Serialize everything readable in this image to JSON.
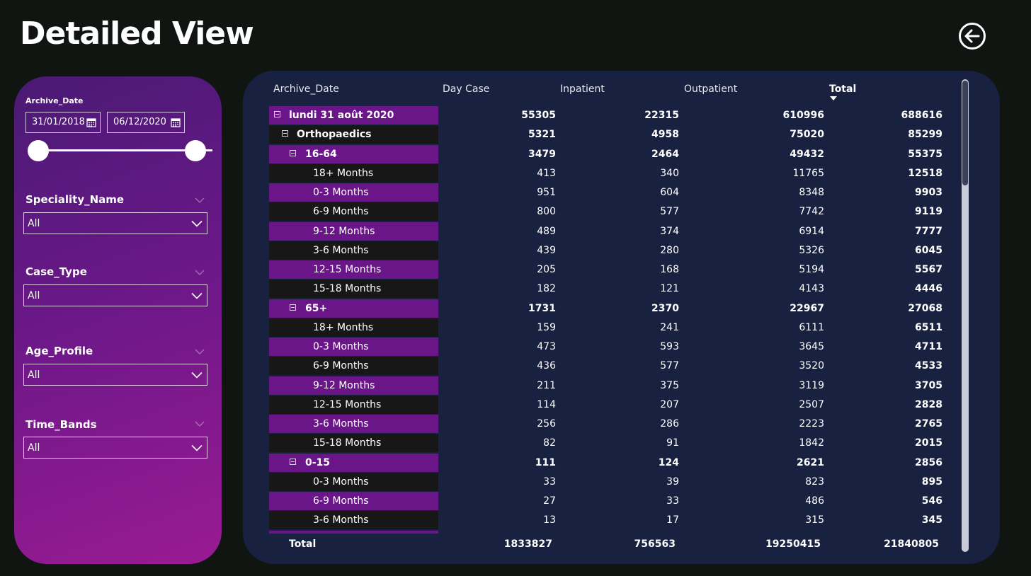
{
  "page": {
    "title": "Detailed View"
  },
  "date_filter": {
    "label": "Archive_Date",
    "start": "31/01/2018",
    "end": "06/12/2020"
  },
  "filters": [
    {
      "label": "Speciality_Name",
      "value": "All"
    },
    {
      "label": "Case_Type",
      "value": "All"
    },
    {
      "label": "Age_Profile",
      "value": "All"
    },
    {
      "label": "Time_Bands",
      "value": "All"
    }
  ],
  "table": {
    "columns": [
      "Archive_Date",
      "Day Case",
      "Inpatient",
      "Outpatient",
      "Total"
    ],
    "rows": [
      {
        "level": 0,
        "label": "lundi 31 août 2020",
        "day_case": "55305",
        "inpatient": "22315",
        "outpatient": "610996",
        "total": "688616"
      },
      {
        "level": 1,
        "label": "Orthopaedics",
        "day_case": "5321",
        "inpatient": "4958",
        "outpatient": "75020",
        "total": "85299"
      },
      {
        "level": 2,
        "label": "16-64",
        "day_case": "3479",
        "inpatient": "2464",
        "outpatient": "49432",
        "total": "55375"
      },
      {
        "level": 3,
        "label": "18+ Months",
        "day_case": "413",
        "inpatient": "340",
        "outpatient": "11765",
        "total": "12518"
      },
      {
        "level": 3,
        "label": "0-3 Months",
        "day_case": "951",
        "inpatient": "604",
        "outpatient": "8348",
        "total": "9903"
      },
      {
        "level": 3,
        "label": "6-9 Months",
        "day_case": "800",
        "inpatient": "577",
        "outpatient": "7742",
        "total": "9119"
      },
      {
        "level": 3,
        "label": "9-12 Months",
        "day_case": "489",
        "inpatient": "374",
        "outpatient": "6914",
        "total": "7777"
      },
      {
        "level": 3,
        "label": "3-6 Months",
        "day_case": "439",
        "inpatient": "280",
        "outpatient": "5326",
        "total": "6045"
      },
      {
        "level": 3,
        "label": "12-15 Months",
        "day_case": "205",
        "inpatient": "168",
        "outpatient": "5194",
        "total": "5567"
      },
      {
        "level": 3,
        "label": "15-18 Months",
        "day_case": "182",
        "inpatient": "121",
        "outpatient": "4143",
        "total": "4446"
      },
      {
        "level": 2,
        "label": "65+",
        "day_case": "1731",
        "inpatient": "2370",
        "outpatient": "22967",
        "total": "27068"
      },
      {
        "level": 3,
        "label": "18+ Months",
        "day_case": "159",
        "inpatient": "241",
        "outpatient": "6111",
        "total": "6511"
      },
      {
        "level": 3,
        "label": "0-3 Months",
        "day_case": "473",
        "inpatient": "593",
        "outpatient": "3645",
        "total": "4711"
      },
      {
        "level": 3,
        "label": "6-9 Months",
        "day_case": "436",
        "inpatient": "577",
        "outpatient": "3520",
        "total": "4533"
      },
      {
        "level": 3,
        "label": "9-12 Months",
        "day_case": "211",
        "inpatient": "375",
        "outpatient": "3119",
        "total": "3705"
      },
      {
        "level": 3,
        "label": "12-15 Months",
        "day_case": "114",
        "inpatient": "207",
        "outpatient": "2507",
        "total": "2828"
      },
      {
        "level": 3,
        "label": "3-6 Months",
        "day_case": "256",
        "inpatient": "286",
        "outpatient": "2223",
        "total": "2765"
      },
      {
        "level": 3,
        "label": "15-18 Months",
        "day_case": "82",
        "inpatient": "91",
        "outpatient": "1842",
        "total": "2015"
      },
      {
        "level": 2,
        "label": "0-15",
        "day_case": "111",
        "inpatient": "124",
        "outpatient": "2621",
        "total": "2856"
      },
      {
        "level": 3,
        "label": "0-3 Months",
        "day_case": "33",
        "inpatient": "39",
        "outpatient": "823",
        "total": "895"
      },
      {
        "level": 3,
        "label": "6-9 Months",
        "day_case": "27",
        "inpatient": "33",
        "outpatient": "486",
        "total": "546"
      },
      {
        "level": 3,
        "label": "3-6 Months",
        "day_case": "13",
        "inpatient": "17",
        "outpatient": "315",
        "total": "345"
      }
    ],
    "total": {
      "label": "Total",
      "day_case": "1833827",
      "inpatient": "756563",
      "outpatient": "19250415",
      "total": "21840805"
    },
    "sort": {
      "column": "Total",
      "direction": "descending"
    }
  },
  "colors": {
    "background": "#101512",
    "table_panel": "#18213f",
    "row_purple": "#6a1588",
    "row_dark": "#171717",
    "panel_gradient_start": "#4a1a74",
    "panel_gradient_end": "#9a1a92"
  },
  "icons": {
    "back": "arrow-left-circle-icon",
    "calendar": "calendar-icon",
    "chevron": "chevron-down-icon",
    "expand": "collapse-minus-icon",
    "sort": "sort-descending-icon"
  }
}
